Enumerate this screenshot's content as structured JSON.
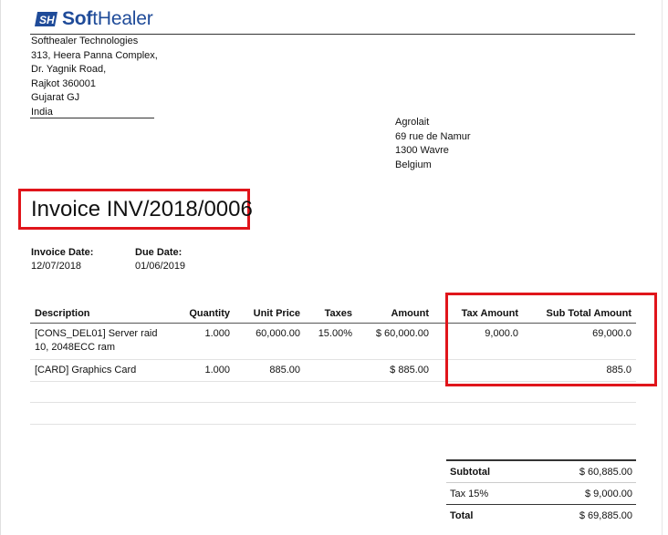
{
  "brand": {
    "logo_text_bold": "Sof",
    "logo_text_rest": "tHealer",
    "colors": {
      "brand_blue": "#1f4b99",
      "highlight_red": "#e0151b"
    }
  },
  "company_address": [
    "Softhealer Technologies",
    "313, Heera Panna Complex,",
    "Dr. Yagnik Road,",
    "Rajkot 360001",
    "Gujarat GJ",
    "India"
  ],
  "customer_address": [
    "Agrolait",
    "69 rue de Namur",
    "1300 Wavre",
    "Belgium"
  ],
  "invoice": {
    "title": "Invoice INV/2018/0006",
    "date_label": "Invoice Date:",
    "date_value": "12/07/2018",
    "due_label": "Due Date:",
    "due_value": "01/06/2019"
  },
  "lines_table": {
    "headers": [
      "Description",
      "Quantity",
      "Unit Price",
      "Taxes",
      "Amount",
      "Tax Amount",
      "Sub Total Amount"
    ],
    "rows": [
      [
        "[CONS_DEL01] Server raid 10, 2048ECC ram",
        "1.000",
        "60,000.00",
        "15.00%",
        "$ 60,000.00",
        "9,000.0",
        "69,000.0"
      ],
      [
        "[CARD] Graphics Card",
        "1.000",
        "885.00",
        "",
        "$ 885.00",
        "",
        "885.0"
      ]
    ]
  },
  "totals": {
    "subtotal_label": "Subtotal",
    "subtotal_value": "$ 60,885.00",
    "tax_label": "Tax 15%",
    "tax_value": "$ 9,000.00",
    "total_label": "Total",
    "total_value": "$ 69,885.00"
  }
}
